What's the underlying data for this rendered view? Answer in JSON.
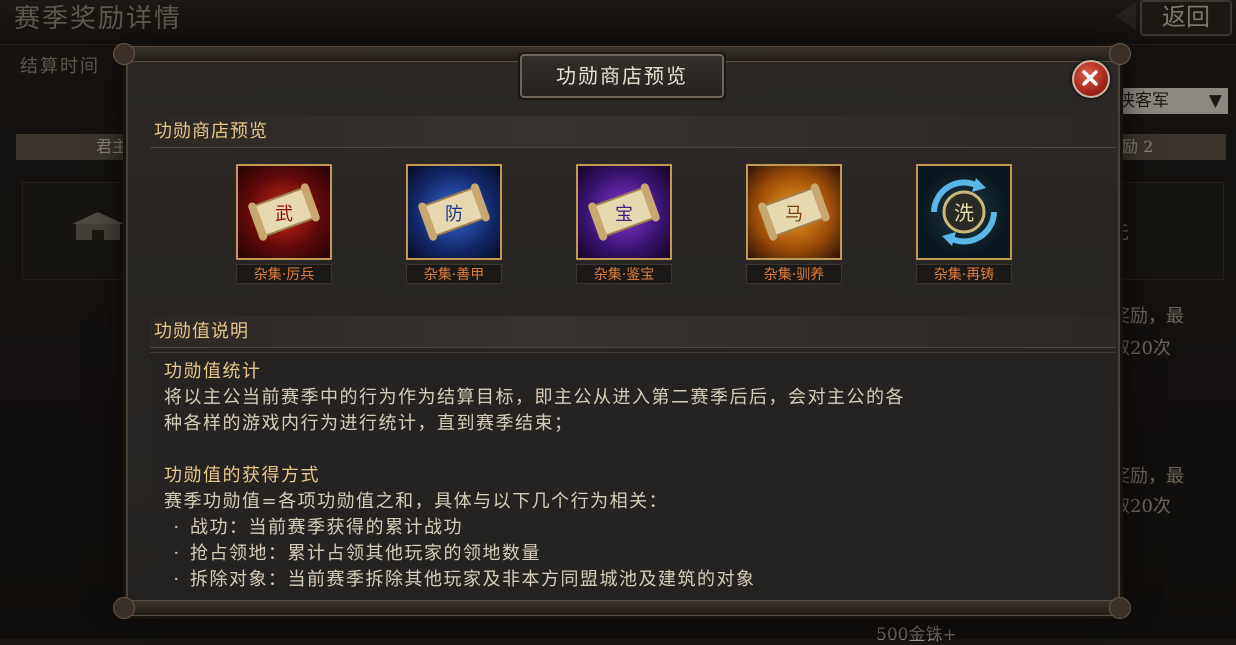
{
  "background": {
    "title": "赛季奖励详情",
    "back_label": "返回",
    "subtitle": "结算时间",
    "dropdown_value": "侠客军",
    "tab_left_label": "君主",
    "tab_right_label": "励 2",
    "right_panel_text": "无",
    "right_text_1a": "奖励，最",
    "right_text_1b": "取20次",
    "right_text_2a": "奖励，最",
    "right_text_2b": "取20次",
    "bottom_text": "500金铢+"
  },
  "modal": {
    "header_title": "功勋商店预览",
    "shop_section_title": "功勋商店预览",
    "items": [
      {
        "label": "杂集·厉兵",
        "glyph": "武",
        "icon": "scroll-icon",
        "bg": "#8a1010"
      },
      {
        "label": "杂集·善甲",
        "glyph": "防",
        "icon": "scroll-icon",
        "bg": "#1a3a8a"
      },
      {
        "label": "杂集·鉴宝",
        "glyph": "宝",
        "icon": "scroll-icon",
        "bg": "#4a1a7a"
      },
      {
        "label": "杂集·驯养",
        "glyph": "马",
        "icon": "scroll-icon",
        "bg": "#b86410"
      },
      {
        "label": "杂集·再铸",
        "glyph": "洗",
        "icon": "reforge-icon",
        "bg": "#102430"
      }
    ],
    "desc_section_title": "功勋值说明",
    "desc": {
      "stat_heading": "功勋值统计",
      "stat_line_1": "将以主公当前赛季中的行为作为结算目标，即主公从进入第二赛季后后，会对主公的各",
      "stat_line_2": "种各样的游戏内行为进行统计，直到赛季结束；",
      "gain_heading": "功勋值的获得方式",
      "gain_intro": "赛季功勋值=各项功勋值之和，具体与以下几个行为相关：",
      "bullets": [
        "战功：当前赛季获得的累计战功",
        "抢占领地：累计占领其他玩家的领地数量",
        "拆除对象：当前赛季拆除其他玩家及非本方同盟城池及建筑的对象"
      ]
    }
  }
}
